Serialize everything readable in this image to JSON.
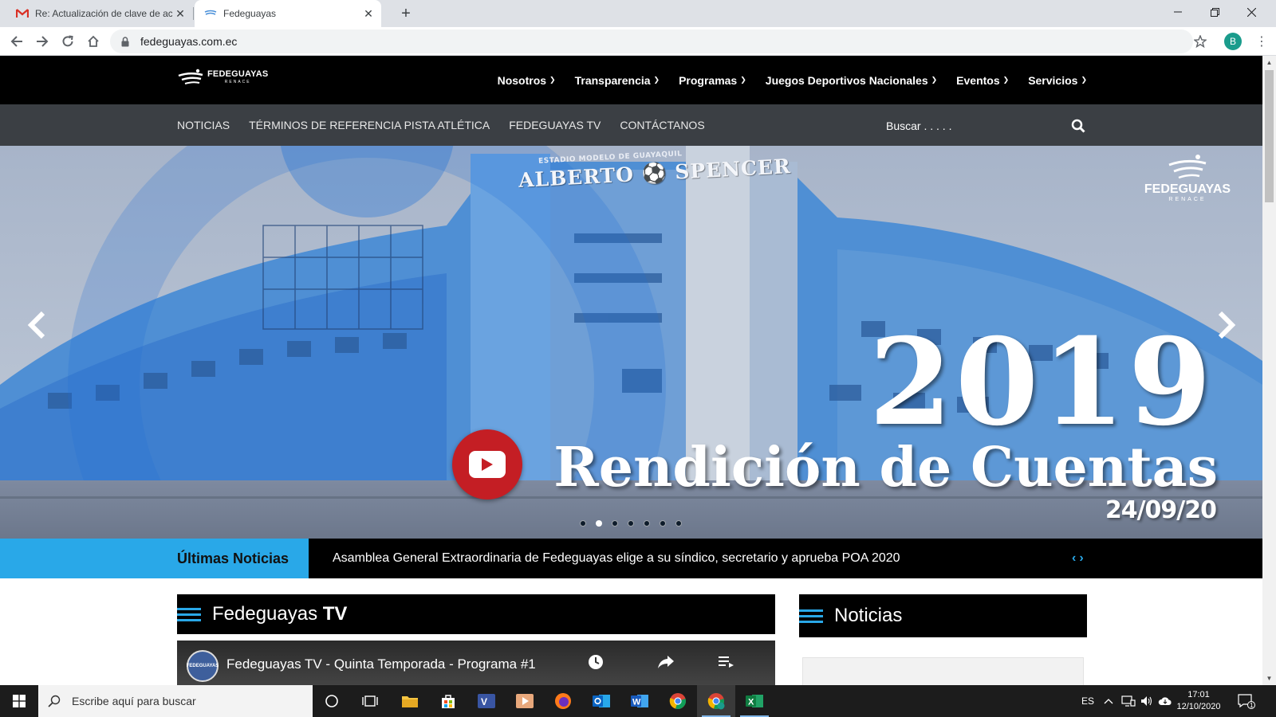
{
  "browser": {
    "tabs": [
      {
        "title": "Re: Actualización de clave de acceso",
        "icon": "gmail-icon",
        "active": false
      },
      {
        "title": "Fedeguayas",
        "icon": "fedeguayas-favicon",
        "active": true
      }
    ],
    "url": "fedeguayas.com.ec",
    "profile_initial": "B"
  },
  "site": {
    "logo": {
      "main": "FEDEGUAYAS",
      "sub": "RENACE"
    },
    "main_menu": [
      {
        "label": "Nosotros"
      },
      {
        "label": "Transparencia"
      },
      {
        "label": "Programas"
      },
      {
        "label": "Juegos Deportivos Nacionales"
      },
      {
        "label": "Eventos"
      },
      {
        "label": "Servicios"
      }
    ],
    "sub_menu": [
      {
        "label": "NOTICIAS"
      },
      {
        "label": "TÉRMINOS DE REFERENCIA PISTA ATLÉTICA"
      },
      {
        "label": "FEDEGUAYAS TV"
      },
      {
        "label": "CONTÁCTANOS"
      }
    ],
    "search_placeholder": "Buscar . . . . .",
    "hero": {
      "stadium_sign_top": "ESTADIO MODELO DE GUAYAQUIL",
      "stadium_sign": "ALBERTO ⚽ SPENCER",
      "logo_main": "FEDEGUAYAS",
      "logo_sub": "RENACE",
      "year": "2019",
      "title": "Rendición de Cuentas",
      "date": "24/09/20",
      "slide_count": 7,
      "active_slide": 2
    },
    "ticker": {
      "label": "Últimas Noticias",
      "headline": "Asamblea General Extraordinaria de Fedeguayas elige a su síndico, secretario y aprueba POA 2020",
      "prev": "‹",
      "next": "›"
    },
    "tv_section": {
      "title_regular": "Fedeguayas ",
      "title_bold": "TV"
    },
    "video": {
      "channel": "FEDEGUAYAS",
      "title": "Fedeguayas TV - Quinta Temporada - Programa #1"
    },
    "news_section": {
      "title": "Noticias"
    }
  },
  "taskbar": {
    "search_placeholder": "Escribe aquí para buscar",
    "language": "ES",
    "time": "17:01",
    "date": "12/10/2020",
    "notification_count": "1"
  },
  "colors": {
    "accent_blue": "#29a8e8",
    "nav_black": "#000000",
    "subnav_gray": "#3b3f44",
    "youtube_red": "#c41e24"
  }
}
